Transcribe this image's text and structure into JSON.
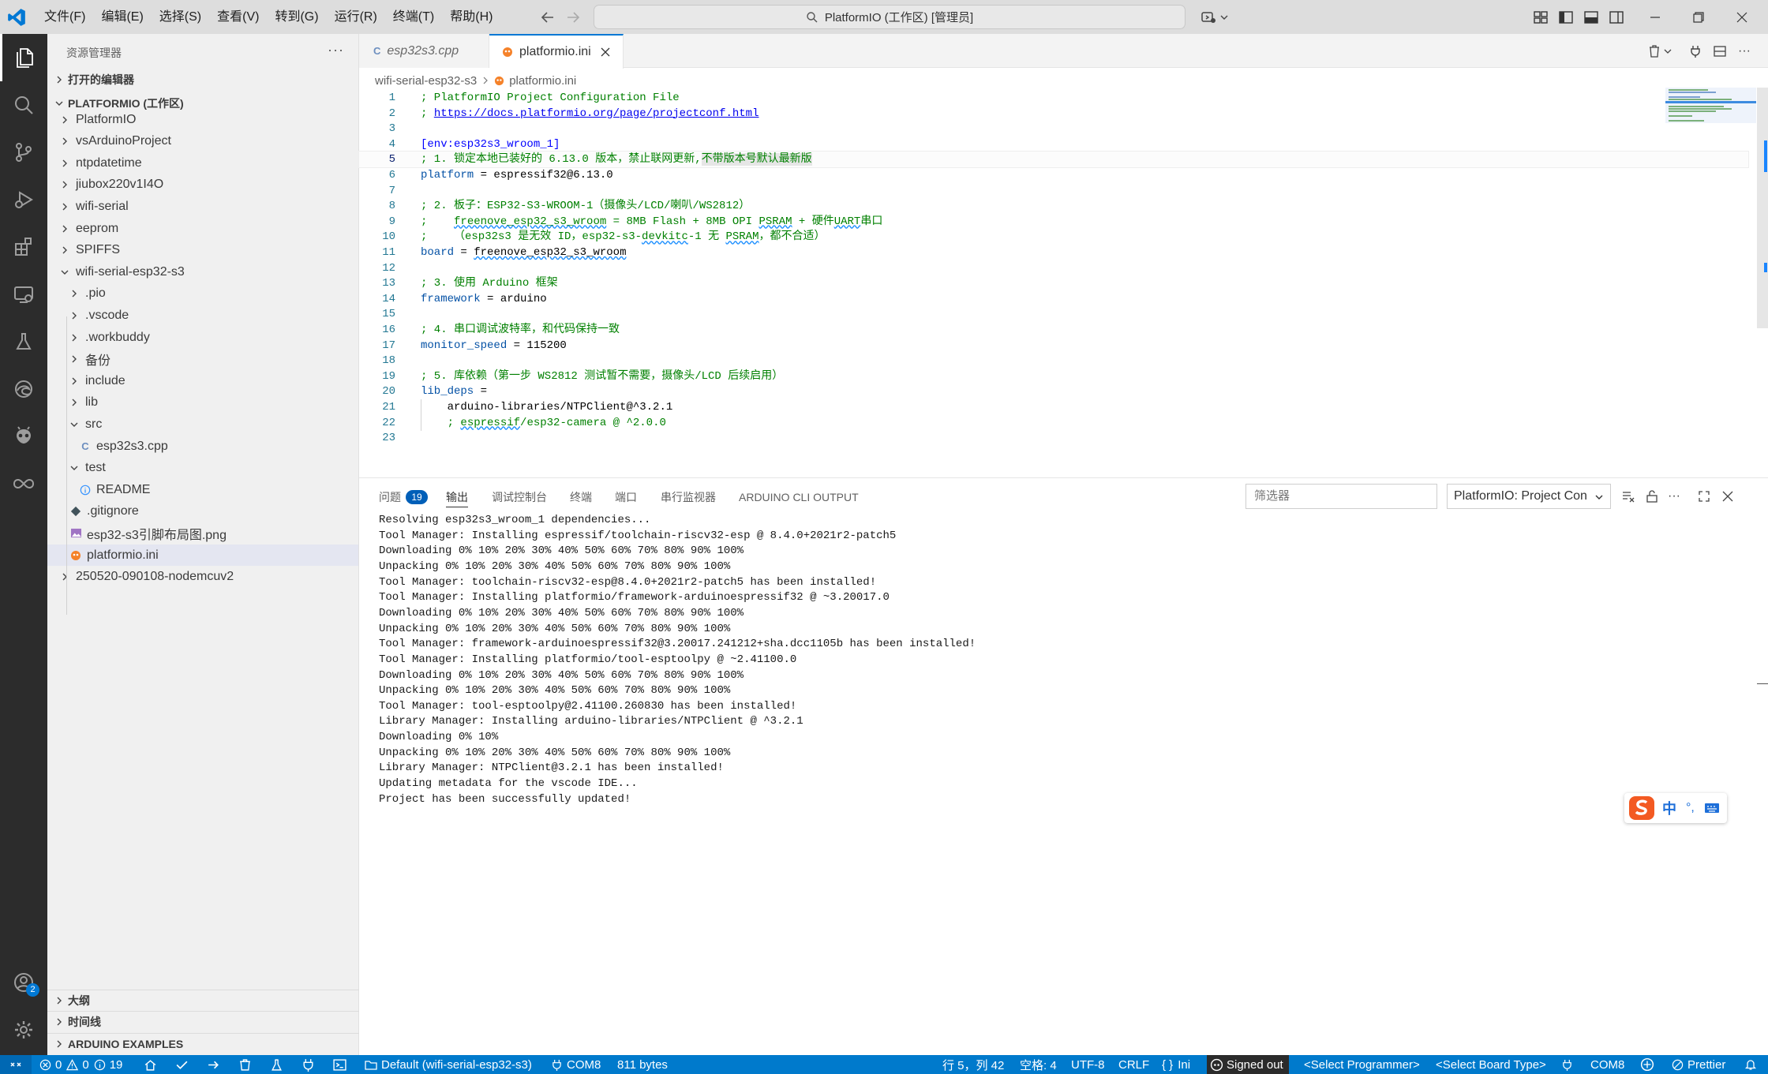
{
  "menubar": [
    "文件(F)",
    "编辑(E)",
    "选择(S)",
    "查看(V)",
    "转到(G)",
    "运行(R)",
    "终端(T)",
    "帮助(H)"
  ],
  "command_center": "PlatformIO (工作区) [管理员]",
  "sidebar": {
    "title": "资源管理器",
    "open_editors": "打开的编辑器",
    "workspace": "PLATFORMIO (工作区)",
    "tree": [
      {
        "label": "PlatformIO",
        "type": "folder"
      },
      {
        "label": "vsArduinoProject",
        "type": "folder"
      },
      {
        "label": "ntpdatetime",
        "type": "folder"
      },
      {
        "label": "jiubox220v1I4O",
        "type": "folder"
      },
      {
        "label": "wifi-serial",
        "type": "folder"
      },
      {
        "label": "eeprom",
        "type": "folder"
      },
      {
        "label": "SPIFFS",
        "type": "folder"
      },
      {
        "label": "wifi-serial-esp32-s3",
        "type": "folder-open"
      },
      {
        "label": ".pio",
        "type": "folder"
      },
      {
        "label": ".vscode",
        "type": "folder"
      },
      {
        "label": ".workbuddy",
        "type": "folder"
      },
      {
        "label": "备份",
        "type": "folder"
      },
      {
        "label": "include",
        "type": "folder"
      },
      {
        "label": "lib",
        "type": "folder"
      },
      {
        "label": "src",
        "type": "folder-open"
      },
      {
        "label": "esp32s3.cpp",
        "type": "cpp"
      },
      {
        "label": "test",
        "type": "folder-open"
      },
      {
        "label": "README",
        "type": "info"
      },
      {
        "label": ".gitignore",
        "type": "git"
      },
      {
        "label": "esp32-s3引脚布局图.png",
        "type": "image"
      },
      {
        "label": "platformio.ini",
        "type": "pio"
      },
      {
        "label": "250520-090108-nodemcuv2",
        "type": "folder"
      }
    ],
    "outline": "大纲",
    "timeline": "时间线",
    "arduino_examples": "ARDUINO EXAMPLES"
  },
  "tabs": [
    {
      "label": "esp32s3.cpp",
      "active": false
    },
    {
      "label": "platformio.ini",
      "active": true
    }
  ],
  "breadcrumb": {
    "folder": "wifi-serial-esp32-s3",
    "file": "platformio.ini"
  },
  "code_lines": [
    "; PlatformIO Project Configuration File",
    "; https://docs.platformio.org/page/projectconf.html",
    "",
    "[env:esp32s3_wroom_1]",
    "; 1. 锁定本地已装好的 6.13.0 版本，禁止联网更新,不带版本号默认最新版",
    "platform = espressif32@6.13.0",
    "",
    "; 2. 板子：ESP32-S3-WROOM-1（摄像头/LCD/喇叭/WS2812）",
    ";    freenove_esp32_s3_wroom = 8MB Flash + 8MB OPI PSRAM + 硬件UART串口",
    ";    （esp32s3 是无效 ID，esp32-s3-devkitc-1 无 PSRAM，都不合适）",
    "board = freenove_esp32_s3_wroom",
    "",
    "; 3. 使用 Arduino 框架",
    "framework = arduino",
    "",
    "; 4. 串口调试波特率，和代码保持一致",
    "monitor_speed = 115200",
    "",
    "; 5. 库依赖（第一步 WS2812 测试暂不需要，摄像头/LCD 后续启用）",
    "lib_deps =",
    "    arduino-libraries/NTPClient@^3.2.1",
    "    ; espressif/esp32-camera @ ^2.0.0",
    ""
  ],
  "panel": {
    "tabs": [
      {
        "label": "问题",
        "badge": "19"
      },
      {
        "label": "输出",
        "active": true
      },
      {
        "label": "调试控制台"
      },
      {
        "label": "终端"
      },
      {
        "label": "端口"
      },
      {
        "label": "串行监视器"
      },
      {
        "label": "ARDUINO CLI OUTPUT"
      }
    ],
    "filter_placeholder": "筛选器",
    "output_channel": "PlatformIO: Project Con",
    "output_lines": [
      "Resolving esp32s3_wroom_1 dependencies...",
      "Tool Manager: Installing espressif/toolchain-riscv32-esp @ 8.4.0+2021r2-patch5",
      "Downloading 0% 10% 20% 30% 40% 50% 60% 70% 80% 90% 100%",
      "Unpacking 0% 10% 20% 30% 40% 50% 60% 70% 80% 90% 100%",
      "Tool Manager: toolchain-riscv32-esp@8.4.0+2021r2-patch5 has been installed!",
      "Tool Manager: Installing platformio/framework-arduinoespressif32 @ ~3.20017.0",
      "Downloading 0% 10% 20% 30% 40% 50% 60% 70% 80% 90% 100%",
      "Unpacking 0% 10% 20% 30% 40% 50% 60% 70% 80% 90% 100%",
      "Tool Manager: framework-arduinoespressif32@3.20017.241212+sha.dcc1105b has been installed!",
      "Tool Manager: Installing platformio/tool-esptoolpy @ ~2.41100.0",
      "Downloading 0% 10% 20% 30% 40% 50% 60% 70% 80% 90% 100%",
      "Unpacking 0% 10% 20% 30% 40% 50% 60% 70% 80% 90% 100%",
      "Tool Manager: tool-esptoolpy@2.41100.260830 has been installed!",
      "Library Manager: Installing arduino-libraries/NTPClient @ ^3.2.1",
      "Downloading 0% 10%",
      "Unpacking 0% 10% 20% 30% 40% 50% 60% 70% 80% 90% 100%",
      "Library Manager: NTPClient@3.2.1 has been installed!",
      "Updating metadata for the vscode IDE...",
      "Project has been successfully updated!"
    ]
  },
  "ime": {
    "mode": "中",
    "punct": "°,"
  },
  "accounts_badge": "2",
  "statusbar": {
    "errors": "0",
    "warnings": "0",
    "infos": "19",
    "env": "Default (wifi-serial-esp32-s3)",
    "port": "COM8",
    "bytes": "811 bytes",
    "cursor": "行 5，列 42",
    "spaces": "空格: 4",
    "encoding": "UTF-8",
    "eol": "CRLF",
    "language": "Ini",
    "signed_out": "Signed out",
    "programmer": "<Select Programmer>",
    "board_type": "<Select Board Type>",
    "port2": "COM8",
    "prettier": "Prettier"
  },
  "colors": {
    "statusbar": "#007acc",
    "activitybar": "#2c2c2c",
    "accent": "#0078d4"
  }
}
